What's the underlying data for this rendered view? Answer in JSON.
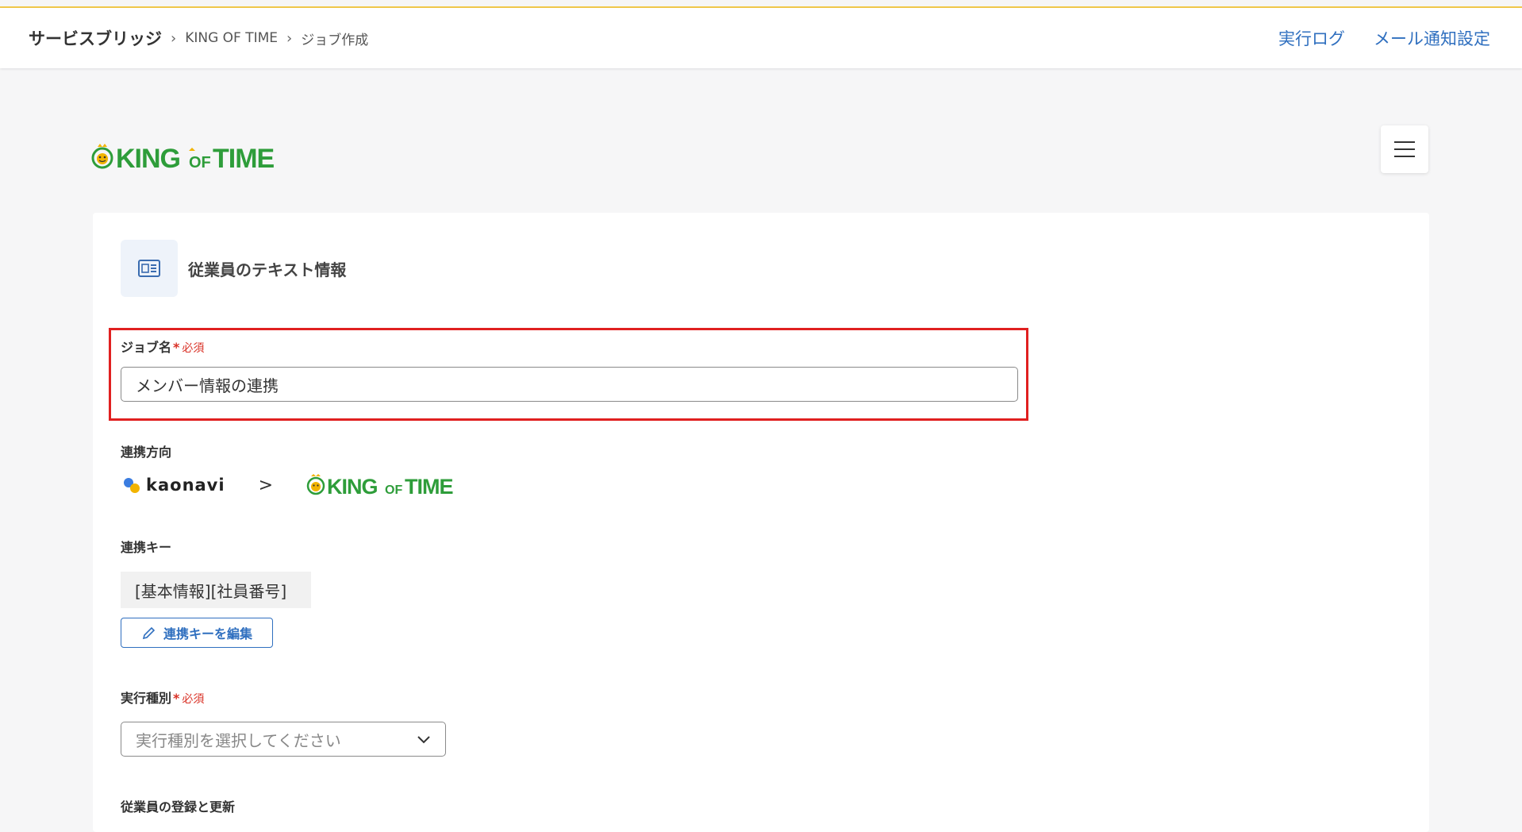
{
  "breadcrumb": {
    "root": "サービスブリッジ",
    "level1": "KING OF TIME",
    "level2": "ジョブ作成"
  },
  "header_links": {
    "exec_log": "実行ログ",
    "mail_settings": "メール通知設定"
  },
  "logo": {
    "king": "KING",
    "of": "OF",
    "time": "TIME",
    "brand_color": "#2e9d3a"
  },
  "card": {
    "title": "従業員のテキスト情報"
  },
  "job_name": {
    "label": "ジョブ名",
    "required": "必須",
    "value": "メンバー情報の連携"
  },
  "direction": {
    "label": "連携方向",
    "from": "kaonavi",
    "arrow": ">"
  },
  "key": {
    "label": "連携キー",
    "value": "[基本情報][社員番号]",
    "edit_button": "連携キーを編集"
  },
  "exec_type": {
    "label": "実行種別",
    "required": "必須",
    "placeholder": "実行種別を選択してください"
  },
  "next_section": {
    "label": "従業員の登録と更新"
  },
  "colors": {
    "accent": "#2f6fbf",
    "required": "#d93025",
    "highlight": "#e02020",
    "header_line": "#f2c94c"
  }
}
